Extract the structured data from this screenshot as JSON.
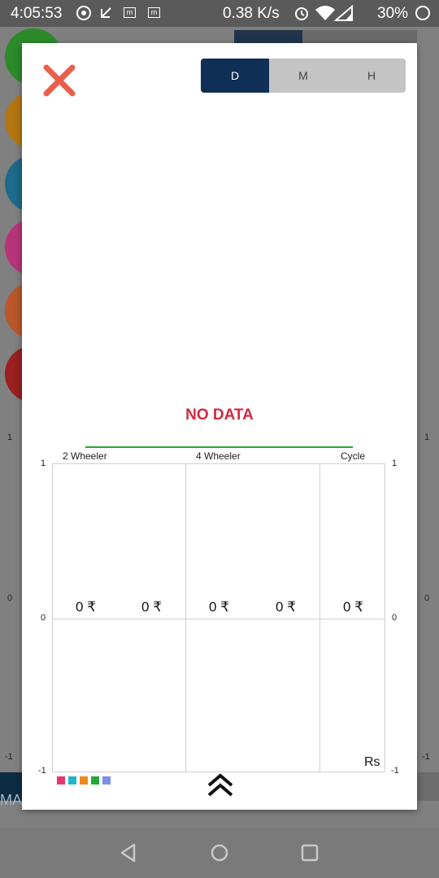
{
  "status_bar": {
    "time": "4:05:53",
    "speed": "0.38 K/s",
    "battery": "30%",
    "icons": [
      "music-icon",
      "signal-arrow-icon",
      "m-app-icon",
      "m-app-icon",
      "alarm-icon",
      "wifi-icon",
      "cell-signal-icon",
      "battery-icon"
    ],
    "m_icon_text": "m"
  },
  "background": {
    "circle_colors": [
      "#2c8a2a",
      "#b27510",
      "#1d6a8a",
      "#b8347a",
      "#b9562a",
      "#9a1f1f"
    ],
    "axis_ticks": {
      "top": "1",
      "middle": "0",
      "bottom": "-1"
    },
    "bottom_text": "MA"
  },
  "dialog": {
    "close_icon": "close-x-icon",
    "segment": {
      "options": [
        "D",
        "M",
        "H"
      ],
      "selected": "D"
    },
    "no_data_text": "NO DATA"
  },
  "chart_data": {
    "type": "bar",
    "categories": [
      "2 Wheeler",
      "4 Wheeler",
      "Cycle"
    ],
    "value_labels": [
      "0 ₹",
      "0 ₹",
      "0 ₹",
      "0 ₹",
      "0 ₹"
    ],
    "values": [
      0,
      0,
      0,
      0,
      0
    ],
    "ylim": [
      -1,
      1
    ],
    "y_ticks": [
      "1",
      "0",
      "-1"
    ],
    "unit_label": "Rs",
    "grid": true,
    "legend_colors": [
      "#e63674",
      "#1fb8c9",
      "#f08a1c",
      "#26a83c",
      "#7b8fe8"
    ]
  },
  "navigation": {
    "expand_icon": "double-chevron-up-icon",
    "nav_icons": [
      "back-icon",
      "home-icon",
      "recents-icon"
    ]
  },
  "colors": {
    "accent": "#102f57",
    "no_data": "#d22a3e",
    "close": "#e8604c",
    "green_line": "#29a52e"
  }
}
